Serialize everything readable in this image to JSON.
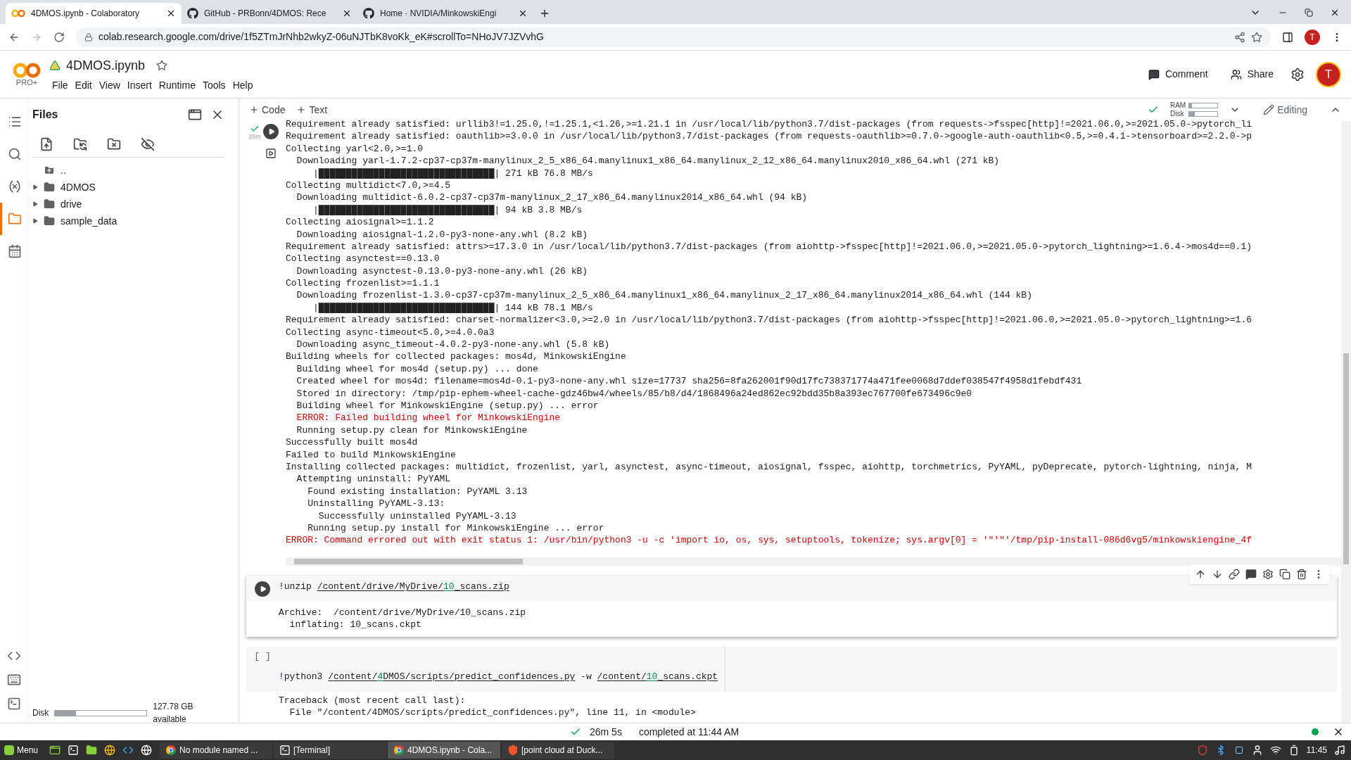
{
  "browser": {
    "tabs": [
      {
        "title": "4DMOS.ipynb - Colaboratory",
        "kind": "colab",
        "selected": true
      },
      {
        "title": "GitHub - PRBonn/4DMOS: Rece",
        "kind": "github",
        "selected": false
      },
      {
        "title": "Home · NVIDIA/MinkowskiEngi",
        "kind": "github",
        "selected": false
      }
    ],
    "url": "colab.research.google.com/drive/1f5ZTmJrNhb2wkyZ-06uNJTbK8voKk_eK#scrollTo=NHoJV7JZVvhG",
    "profile": "T"
  },
  "header": {
    "plan": "PRO+",
    "title": "4DMOS.ipynb",
    "menu": [
      "File",
      "Edit",
      "View",
      "Insert",
      "Runtime",
      "Tools",
      "Help"
    ],
    "comment": "Comment",
    "share": "Share",
    "avatar": "T"
  },
  "toolbar": {
    "add_code": "Code",
    "add_text": "Text",
    "ram": {
      "label": "RAM",
      "level": 0.1
    },
    "disk": {
      "label": "Disk",
      "level": 0.2
    },
    "mode": "Editing"
  },
  "rail": [
    {
      "kind": "toc",
      "selected": false
    },
    {
      "kind": "search",
      "selected": false
    },
    {
      "kind": "variables",
      "selected": false
    },
    {
      "kind": "files",
      "selected": true
    },
    {
      "kind": "calendar",
      "selected": false
    }
  ],
  "rail_bottom": [
    {
      "kind": "snippets"
    },
    {
      "kind": "palette"
    },
    {
      "kind": "terminal"
    }
  ],
  "files": {
    "title": "Files",
    "tree": [
      {
        "name": "..",
        "kind": "parent"
      },
      {
        "name": "4DMOS",
        "kind": "folder",
        "expanded": false
      },
      {
        "name": "drive",
        "kind": "folder",
        "expanded": false
      },
      {
        "name": "sample_data",
        "kind": "folder",
        "expanded": false
      }
    ],
    "disk": {
      "label": "Disk",
      "level": 0.23,
      "available": "127.78 GB available"
    }
  },
  "cells": [
    {
      "kind": "finished",
      "time": "26m",
      "output": [
        {
          "text": "Requirement already satisfied: urllib3!=1.25.0,!=1.25.1,<1.26,>=1.21.1 in /usr/local/lib/python3.7/dist-packages (from requests->fsspec[http]!=2021.06.0,>=2021.05.0->pytorch_li",
          "kind": "normal"
        },
        {
          "text": "Requirement already satisfied: oauthlib>=3.0.0 in /usr/local/lib/python3.7/dist-packages (from requests-oauthlib>=0.7.0->google-auth-oauthlib<0.5,>=0.4.1->tensorboard>=2.2.0->p",
          "kind": "normal"
        },
        {
          "text": "Collecting yarl<2.0,>=1.0",
          "kind": "normal"
        },
        {
          "text": "  Downloading yarl-1.7.2-cp37-cp37m-manylinux_2_5_x86_64.manylinux1_x86_64.manylinux_2_12_x86_64.manylinux2010_x86_64.whl (271 kB)",
          "kind": "normal"
        },
        {
          "text": "     |████████████████████████████████| 271 kB 76.8 MB/s",
          "kind": "normal"
        },
        {
          "text": "Collecting multidict<7.0,>=4.5",
          "kind": "normal"
        },
        {
          "text": "  Downloading multidict-6.0.2-cp37-cp37m-manylinux_2_17_x86_64.manylinux2014_x86_64.whl (94 kB)",
          "kind": "normal"
        },
        {
          "text": "     |████████████████████████████████| 94 kB 3.8 MB/s",
          "kind": "normal"
        },
        {
          "text": "Collecting aiosignal>=1.1.2",
          "kind": "normal"
        },
        {
          "text": "  Downloading aiosignal-1.2.0-py3-none-any.whl (8.2 kB)",
          "kind": "normal"
        },
        {
          "text": "Requirement already satisfied: attrs>=17.3.0 in /usr/local/lib/python3.7/dist-packages (from aiohttp->fsspec[http]!=2021.06.0,>=2021.05.0->pytorch_lightning>=1.6.4->mos4d==0.1)",
          "kind": "normal"
        },
        {
          "text": "Collecting asynctest==0.13.0",
          "kind": "normal"
        },
        {
          "text": "  Downloading asynctest-0.13.0-py3-none-any.whl (26 kB)",
          "kind": "normal"
        },
        {
          "text": "Collecting frozenlist>=1.1.1",
          "kind": "normal"
        },
        {
          "text": "  Downloading frozenlist-1.3.0-cp37-cp37m-manylinux_2_5_x86_64.manylinux1_x86_64.manylinux_2_17_x86_64.manylinux2014_x86_64.whl (144 kB)",
          "kind": "normal"
        },
        {
          "text": "     |████████████████████████████████| 144 kB 78.1 MB/s",
          "kind": "normal"
        },
        {
          "text": "Requirement already satisfied: charset-normalizer<3.0,>=2.0 in /usr/local/lib/python3.7/dist-packages (from aiohttp->fsspec[http]!=2021.06.0,>=2021.05.0->pytorch_lightning>=1.6",
          "kind": "normal"
        },
        {
          "text": "Collecting async-timeout<5.0,>=4.0.0a3",
          "kind": "normal"
        },
        {
          "text": "  Downloading async_timeout-4.0.2-py3-none-any.whl (5.8 kB)",
          "kind": "normal"
        },
        {
          "text": "Building wheels for collected packages: mos4d, MinkowskiEngine",
          "kind": "normal"
        },
        {
          "text": "  Building wheel for mos4d (setup.py) ... done",
          "kind": "normal"
        },
        {
          "text": "  Created wheel for mos4d: filename=mos4d-0.1-py3-none-any.whl size=17737 sha256=8fa262001f90d17fc738371774a471fee0068d7ddef038547f4958d1febdf431",
          "kind": "normal"
        },
        {
          "text": "  Stored in directory: /tmp/pip-ephem-wheel-cache-gdz46bw4/wheels/85/b8/d4/1868496a24ed862ec92bdd35b8a393ec767700fe673496c9e0",
          "kind": "normal"
        },
        {
          "text": "  Building wheel for MinkowskiEngine (setup.py) ... error",
          "kind": "normal"
        },
        {
          "text": "  ERROR: Failed building wheel for MinkowskiEngine",
          "kind": "error"
        },
        {
          "text": "  Running setup.py clean for MinkowskiEngine",
          "kind": "normal"
        },
        {
          "text": "Successfully built mos4d",
          "kind": "normal"
        },
        {
          "text": "Failed to build MinkowskiEngine",
          "kind": "normal"
        },
        {
          "text": "Installing collected packages: multidict, frozenlist, yarl, asynctest, async-timeout, aiosignal, fsspec, aiohttp, torchmetrics, PyYAML, pyDeprecate, pytorch-lightning, ninja, M",
          "kind": "normal"
        },
        {
          "text": "  Attempting uninstall: PyYAML",
          "kind": "normal"
        },
        {
          "text": "    Found existing installation: PyYAML 3.13",
          "kind": "normal"
        },
        {
          "text": "    Uninstalling PyYAML-3.13:",
          "kind": "normal"
        },
        {
          "text": "      Successfully uninstalled PyYAML-3.13",
          "kind": "normal"
        },
        {
          "text": "    Running setup.py install for MinkowskiEngine ... error",
          "kind": "normal"
        },
        {
          "text": "ERROR: Command errored out with exit status 1: /usr/bin/python3 -u -c 'import io, os, sys, setuptools, tokenize; sys.argv[0] = '\"'\"'/tmp/pip-install-086d6vg5/minkowskiengine_4f",
          "kind": "error"
        }
      ]
    },
    {
      "kind": "ready",
      "focused": true,
      "code": [
        {
          "text": "!",
          "kind": "bang"
        },
        {
          "text": "unzip ",
          "kind": "plain"
        },
        {
          "text": "/content/drive/MyDrive/",
          "kind": "path"
        },
        {
          "text": "10",
          "kind": "number"
        },
        {
          "text": "_scans.zip",
          "kind": "path"
        }
      ],
      "output": [
        {
          "text": "Archive:  /content/drive/MyDrive/10_scans.zip",
          "kind": "normal"
        },
        {
          "text": "  inflating: 10_scans.ckpt",
          "kind": "normal"
        }
      ]
    },
    {
      "kind": "unrun",
      "label": "[ ]",
      "focused": false,
      "code": [
        {
          "text": "!",
          "kind": "bang"
        },
        {
          "text": "python3 ",
          "kind": "plain"
        },
        {
          "text": "/content/",
          "kind": "path"
        },
        {
          "text": "4",
          "kind": "number"
        },
        {
          "text": "DMOS/scripts/predict_confidences.py",
          "kind": "path"
        },
        {
          "text": " -w ",
          "kind": "plain"
        },
        {
          "text": "/content/",
          "kind": "path"
        },
        {
          "text": "10",
          "kind": "number"
        },
        {
          "text": "_scans.ckpt",
          "kind": "path"
        }
      ],
      "output": [
        {
          "text": "Traceback (most recent call last):",
          "kind": "normal"
        },
        {
          "text": "  File \"/content/4DMOS/scripts/predict_confidences.py\", line 11, in <module>",
          "kind": "normal"
        }
      ]
    }
  ],
  "status_bar": {
    "elapsed": "26m 5s",
    "message": "completed at 11:44 AM"
  },
  "taskbar": {
    "menu": "Menu",
    "windows": [
      {
        "title": "No module named ...",
        "kind": "chrome",
        "selected": false
      },
      {
        "title": "[Terminal]",
        "kind": "terminal",
        "selected": false
      },
      {
        "title": "4DMOS.ipynb - Cola...",
        "kind": "chrome",
        "selected": true
      },
      {
        "title": "[point cloud at Duck...",
        "kind": "brave",
        "selected": false
      }
    ],
    "time": "11:45"
  }
}
